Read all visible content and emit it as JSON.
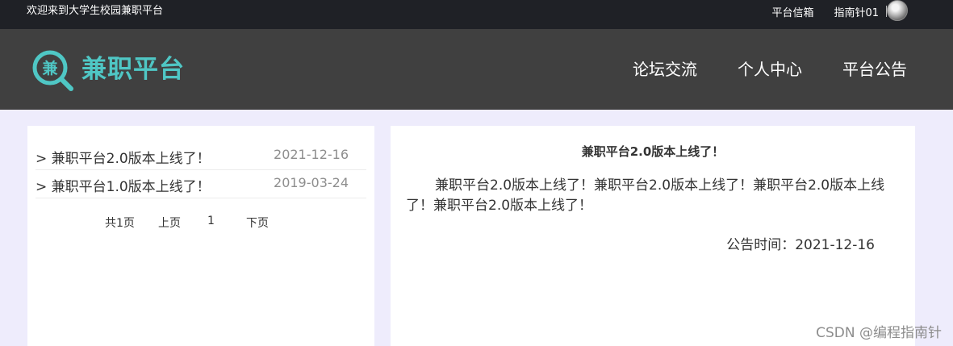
{
  "topbar": {
    "welcome": "欢迎来到大学生校园兼职平台",
    "mailbox": "平台信箱",
    "username": "指南针01"
  },
  "header": {
    "logo_char": "兼",
    "brand": "兼职平台",
    "nav": [
      "论坛交流",
      "个人中心",
      "平台公告"
    ]
  },
  "announcements": {
    "items": [
      {
        "title": "> 兼职平台2.0版本上线了！",
        "date": "2021-12-16"
      },
      {
        "title": "> 兼职平台1.0版本上线了！",
        "date": "2019-03-24"
      }
    ],
    "pager": {
      "total": "共1页",
      "prev": "上页",
      "current": "1",
      "next": "下页"
    }
  },
  "detail": {
    "title": "兼职平台2.0版本上线了！",
    "body": "兼职平台2.0版本上线了！兼职平台2.0版本上线了！兼职平台2.0版本上线了！兼职平台2.0版本上线了！",
    "time": "公告时间：2021-12-16"
  },
  "watermark": "CSDN @编程指南针",
  "colors": {
    "accent": "#4fc7c5",
    "topbar": "#1f2126",
    "navbar": "#404040",
    "page_bg": "#eeecfc"
  }
}
